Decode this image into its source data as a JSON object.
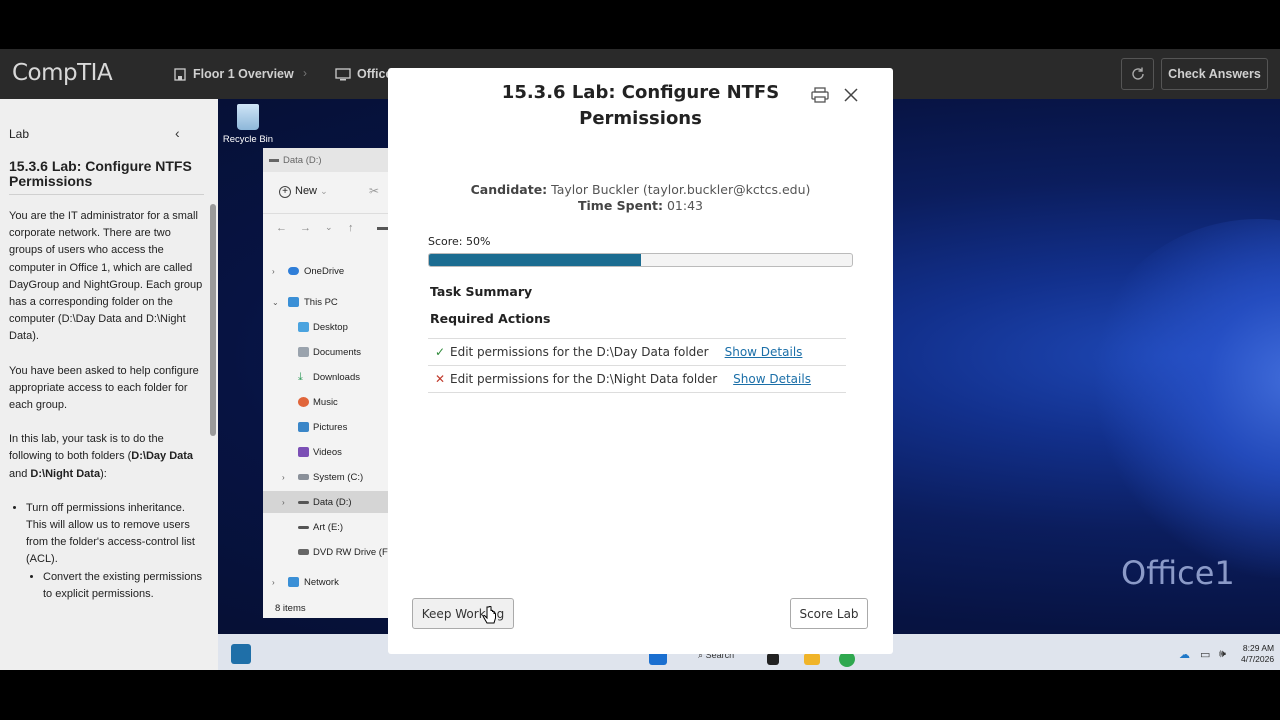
{
  "topbar": {
    "logo": "CompTIA",
    "nav": [
      {
        "label": "Floor 1 Overview",
        "icon": "building-icon"
      },
      {
        "label": "Office",
        "icon": "monitor-icon"
      }
    ],
    "check_answers": "Check Answers"
  },
  "left_panel": {
    "header": "Lab",
    "title": "15.3.6 Lab: Configure NTFS Permissions",
    "p1": "You are the IT administrator for a small corporate network. There are two groups of users who access the computer in Office 1, which are called DayGroup and NightGroup. Each group has a corresponding folder on the computer (D:\\Day Data and D:\\Night Data).",
    "p2": "You have been asked to help configure appropriate access to each folder for each group.",
    "p3_pre": "In this lab, your task is to do the following to both folders (",
    "p3_b1": "D:\\Day Data",
    "p3_mid": " and ",
    "p3_b2": "D:\\Night Data",
    "p3_post": "):",
    "bullet1": "Turn off permissions inheritance. This will allow us to remove users from the folder's access-control list (ACL).",
    "sub1": "Convert the existing permissions to explicit permissions."
  },
  "desktop": {
    "recycle_bin": "Recycle Bin",
    "office_label": "Office1",
    "explorer": {
      "title": "Data (D:)",
      "new_label": "New",
      "tree": [
        "OneDrive",
        "This PC",
        "Desktop",
        "Documents",
        "Downloads",
        "Music",
        "Pictures",
        "Videos",
        "System (C:)",
        "Data (D:)",
        "Art (E:)",
        "DVD RW Drive (F:)",
        "Network"
      ],
      "status": "8 items"
    },
    "taskbar": {
      "search": "Search",
      "time": "8:29 AM",
      "date": "4/7/2026"
    }
  },
  "modal": {
    "title": "15.3.6 Lab: Configure NTFS Permissions",
    "candidate_label": "Candidate:",
    "candidate_value": "Taylor Buckler (taylor.buckler@kctcs.edu)",
    "time_label": "Time Spent:",
    "time_value": "01:43",
    "score_text": "Score: 50%",
    "score_fraction": 0.5,
    "task_summary": "Task Summary",
    "required_actions": "Required Actions",
    "actions": [
      {
        "status": "✓",
        "label": "Edit permissions for the D:\\Day Data folder",
        "link": "Show Details"
      },
      {
        "status": "✕",
        "label": "Edit permissions for the D:\\Night Data folder",
        "link": "Show Details"
      }
    ],
    "keep_working": "Keep Working",
    "score_lab": "Score Lab"
  },
  "colors": {
    "accent": "#1b6c91",
    "link": "#1b6fa8",
    "success": "#2f8a3a",
    "fail": "#c0392b"
  }
}
